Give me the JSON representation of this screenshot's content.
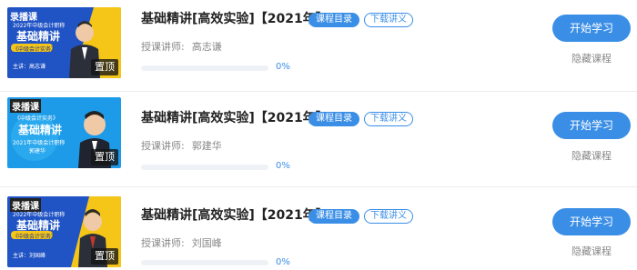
{
  "colors": {
    "accent": "#3a8ee6",
    "title": "#222222",
    "muted": "#888888",
    "divider": "#ececec",
    "banner_blue": "#1e4fb7",
    "banner_light_blue": "#1e9be8",
    "banner_yellow": "#f5c518"
  },
  "courses": [
    {
      "thumbnail": {
        "badge": "录播课",
        "subtitle": "2022年中级会计职称",
        "headline": "基础精讲",
        "book": "《中级会计实务》",
        "teacher_caption": "主讲：高志谦",
        "pin": "置顶"
      },
      "title": "基础精讲[高效实验]【2021年】",
      "tags": {
        "catalog": "课程目录",
        "download": "下载讲义"
      },
      "teacher_label": "授课讲师:",
      "teacher_name": "高志谦",
      "progress_text": "0%",
      "progress_fraction": 0,
      "start_label": "开始学习",
      "hide_label": "隐藏课程"
    },
    {
      "thumbnail": {
        "badge": "录播课",
        "subtitle": "2021年中级会计职称",
        "headline": "基础精讲",
        "book": "《中级会计实务》",
        "teacher_caption": "郭建华",
        "pin": "置顶"
      },
      "title": "基础精讲[高效实验]【2021年】",
      "tags": {
        "catalog": "课程目录",
        "download": "下载讲义"
      },
      "teacher_label": "授课讲师:",
      "teacher_name": "郭建华",
      "progress_text": "0%",
      "progress_fraction": 0,
      "start_label": "开始学习",
      "hide_label": "隐藏课程"
    },
    {
      "thumbnail": {
        "badge": "录播课",
        "subtitle": "2022年中级会计职称",
        "headline": "基础精讲",
        "book": "《中级会计实务》",
        "teacher_caption": "主讲：刘国峰",
        "pin": "置顶"
      },
      "title": "基础精讲[高效实验]【2021年】",
      "tags": {
        "catalog": "课程目录",
        "download": "下载讲义"
      },
      "teacher_label": "授课讲师:",
      "teacher_name": "刘国峰",
      "progress_text": "0%",
      "progress_fraction": 0,
      "start_label": "开始学习",
      "hide_label": "隐藏课程"
    }
  ]
}
